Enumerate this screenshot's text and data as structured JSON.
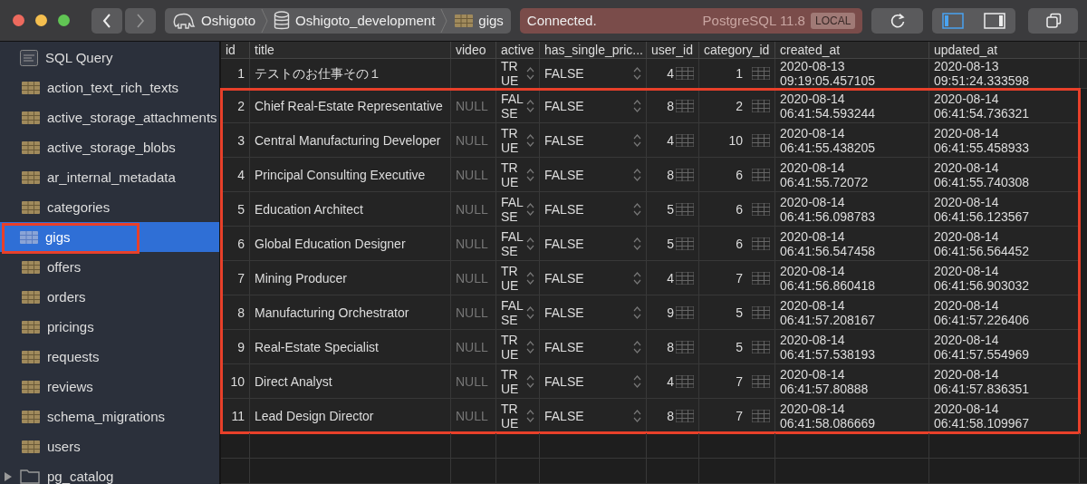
{
  "toolbar": {
    "breadcrumb": [
      {
        "kind": "server",
        "label": "Oshigoto"
      },
      {
        "kind": "database",
        "label": "Oshigoto_development"
      },
      {
        "kind": "table",
        "label": "gigs"
      }
    ],
    "status": {
      "message": "Connected.",
      "server": "PostgreSQL 11.8",
      "badge": "LOCAL"
    },
    "panel_toggles": [
      {
        "kind": "left",
        "selected": true
      },
      {
        "kind": "right",
        "selected": false
      }
    ]
  },
  "sidebar": {
    "items": [
      {
        "kind": "query",
        "label": "SQL Query",
        "selected": false,
        "highlighted": false
      },
      {
        "kind": "table",
        "label": "action_text_rich_texts",
        "selected": false,
        "highlighted": false
      },
      {
        "kind": "table",
        "label": "active_storage_attachments",
        "selected": false,
        "highlighted": false
      },
      {
        "kind": "table",
        "label": "active_storage_blobs",
        "selected": false,
        "highlighted": false
      },
      {
        "kind": "table",
        "label": "ar_internal_metadata",
        "selected": false,
        "highlighted": false
      },
      {
        "kind": "table",
        "label": "categories",
        "selected": false,
        "highlighted": false
      },
      {
        "kind": "table",
        "label": "gigs",
        "selected": true,
        "highlighted": true
      },
      {
        "kind": "table",
        "label": "offers",
        "selected": false,
        "highlighted": false
      },
      {
        "kind": "table",
        "label": "orders",
        "selected": false,
        "highlighted": false
      },
      {
        "kind": "table",
        "label": "pricings",
        "selected": false,
        "highlighted": false
      },
      {
        "kind": "table",
        "label": "requests",
        "selected": false,
        "highlighted": false
      },
      {
        "kind": "table",
        "label": "reviews",
        "selected": false,
        "highlighted": false
      },
      {
        "kind": "table",
        "label": "schema_migrations",
        "selected": false,
        "highlighted": false
      },
      {
        "kind": "table",
        "label": "users",
        "selected": false,
        "highlighted": false
      },
      {
        "kind": "schema",
        "label": "pg_catalog",
        "selected": false,
        "highlighted": false
      }
    ]
  },
  "table": {
    "columns": [
      "id",
      "title",
      "video",
      "active",
      "has_single_pric...",
      "user_id",
      "category_id",
      "created_at",
      "updated_at"
    ],
    "rows": [
      {
        "id": "1",
        "title": "テストのお仕事その１",
        "video": "",
        "active": "TRUE",
        "has_single_price": "FALSE",
        "user_id": "4",
        "category_id": "1",
        "created_at": "2020-08-13 09:19:05.457105",
        "updated_at": "2020-08-13 09:51:24.333598",
        "highlighted": false
      },
      {
        "id": "2",
        "title": "Chief Real-Estate Representative",
        "video": "NULL",
        "active": "FALSE",
        "has_single_price": "FALSE",
        "user_id": "8",
        "category_id": "2",
        "created_at": "2020-08-14 06:41:54.593244",
        "updated_at": "2020-08-14 06:41:54.736321",
        "highlighted": true
      },
      {
        "id": "3",
        "title": "Central Manufacturing Developer",
        "video": "NULL",
        "active": "TRUE",
        "has_single_price": "FALSE",
        "user_id": "4",
        "category_id": "10",
        "created_at": "2020-08-14 06:41:55.438205",
        "updated_at": "2020-08-14 06:41:55.458933",
        "highlighted": true
      },
      {
        "id": "4",
        "title": "Principal Consulting Executive",
        "video": "NULL",
        "active": "TRUE",
        "has_single_price": "FALSE",
        "user_id": "8",
        "category_id": "6",
        "created_at": "2020-08-14 06:41:55.72072",
        "updated_at": "2020-08-14 06:41:55.740308",
        "highlighted": true
      },
      {
        "id": "5",
        "title": "Education Architect",
        "video": "NULL",
        "active": "FALSE",
        "has_single_price": "FALSE",
        "user_id": "5",
        "category_id": "6",
        "created_at": "2020-08-14 06:41:56.098783",
        "updated_at": "2020-08-14 06:41:56.123567",
        "highlighted": true
      },
      {
        "id": "6",
        "title": "Global Education Designer",
        "video": "NULL",
        "active": "FALSE",
        "has_single_price": "FALSE",
        "user_id": "5",
        "category_id": "6",
        "created_at": "2020-08-14 06:41:56.547458",
        "updated_at": "2020-08-14 06:41:56.564452",
        "highlighted": true
      },
      {
        "id": "7",
        "title": "Mining Producer",
        "video": "NULL",
        "active": "TRUE",
        "has_single_price": "FALSE",
        "user_id": "4",
        "category_id": "7",
        "created_at": "2020-08-14 06:41:56.860418",
        "updated_at": "2020-08-14 06:41:56.903032",
        "highlighted": true
      },
      {
        "id": "8",
        "title": "Manufacturing Orchestrator",
        "video": "NULL",
        "active": "FALSE",
        "has_single_price": "FALSE",
        "user_id": "9",
        "category_id": "5",
        "created_at": "2020-08-14 06:41:57.208167",
        "updated_at": "2020-08-14 06:41:57.226406",
        "highlighted": true
      },
      {
        "id": "9",
        "title": "Real-Estate Specialist",
        "video": "NULL",
        "active": "TRUE",
        "has_single_price": "FALSE",
        "user_id": "8",
        "category_id": "5",
        "created_at": "2020-08-14 06:41:57.538193",
        "updated_at": "2020-08-14 06:41:57.554969",
        "highlighted": true
      },
      {
        "id": "10",
        "title": "Direct Analyst",
        "video": "NULL",
        "active": "TRUE",
        "has_single_price": "FALSE",
        "user_id": "4",
        "category_id": "7",
        "created_at": "2020-08-14 06:41:57.80888",
        "updated_at": "2020-08-14 06:41:57.836351",
        "highlighted": true
      },
      {
        "id": "11",
        "title": "Lead Design Director",
        "video": "NULL",
        "active": "TRUE",
        "has_single_price": "FALSE",
        "user_id": "8",
        "category_id": "7",
        "created_at": "2020-08-14 06:41:58.086669",
        "updated_at": "2020-08-14 06:41:58.109967",
        "highlighted": true
      }
    ]
  }
}
